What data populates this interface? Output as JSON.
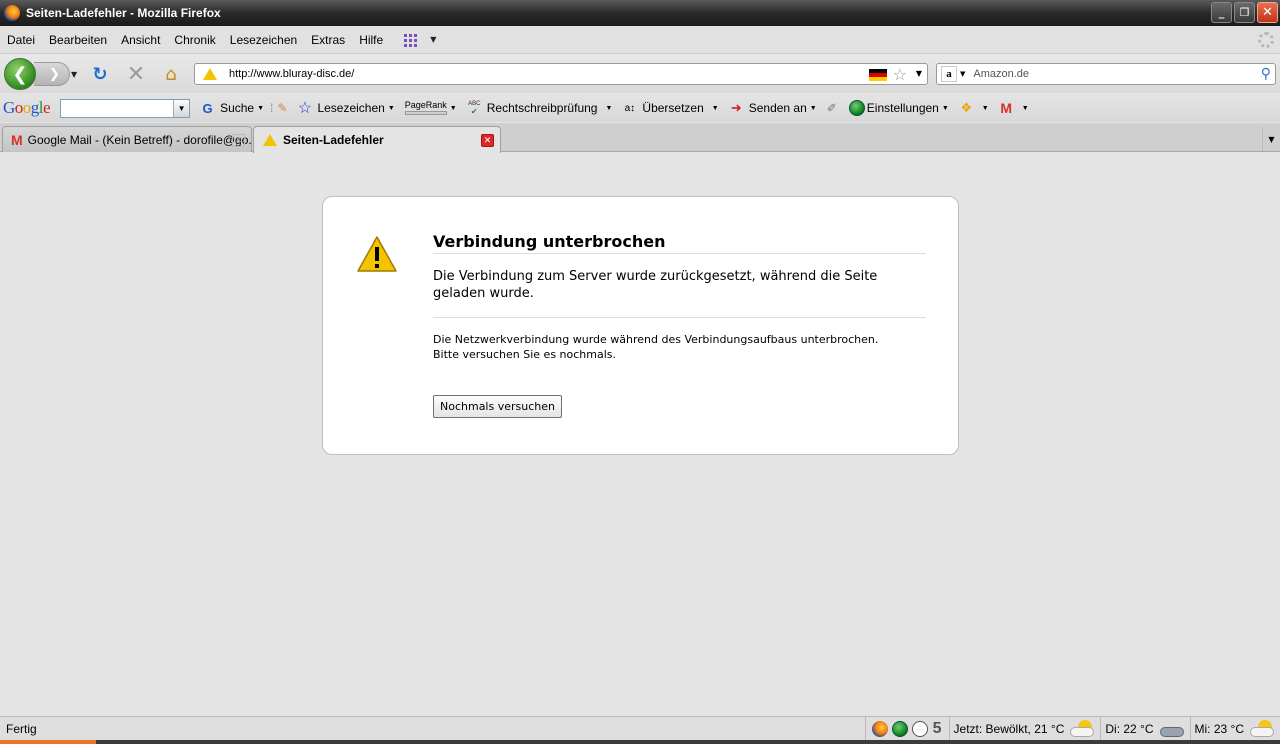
{
  "window": {
    "title": "Seiten-Ladefehler - Mozilla Firefox",
    "buttons": {
      "minimize": "_",
      "maximize": "❐",
      "close": "✕"
    }
  },
  "menubar": {
    "items": [
      "Datei",
      "Bearbeiten",
      "Ansicht",
      "Chronik",
      "Lesezeichen",
      "Extras",
      "Hilfe"
    ]
  },
  "navbar": {
    "url": "http://www.bluray-disc.de/",
    "search_placeholder": "Amazon.de",
    "search_engine_letter": "a"
  },
  "google_toolbar": {
    "logo": [
      "G",
      "o",
      "o",
      "g",
      "l",
      "e"
    ],
    "search_label": "Suche",
    "bookmarks_label": "Lesezeichen",
    "pagerank_label": "PageRank",
    "spellcheck_label": "Rechtschreibprüfung",
    "translate_label": "Übersetzen",
    "send_label": "Senden an",
    "settings_label": "Einstellungen",
    "spellcheck_badge": "ABC",
    "translate_glyph": "a↕"
  },
  "tabs": [
    {
      "label": "Google Mail - (Kein Betreff) - dorofile@go...",
      "active": false
    },
    {
      "label": "Seiten-Ladefehler",
      "active": true
    }
  ],
  "error_page": {
    "title": "Verbindung unterbrochen",
    "short_desc": "Die Verbindung zum Server wurde zurückgesetzt, während die Seite geladen wurde.",
    "long_desc_1": "Die Netzwerkverbindung wurde während des Verbindungsaufbaus unterbrochen.",
    "long_desc_2": "Bitte versuchen Sie es nochmals.",
    "retry_label": "Nochmals versuchen"
  },
  "statusbar": {
    "status": "Fertig",
    "counter": "5",
    "weather_now": "Jetzt: Bewölkt, 21 °C",
    "weather_tue": "Di: 22 °C",
    "weather_wed": "Mi: 23 °C"
  },
  "colors": {
    "accent_green": "#2d8a1e",
    "warning_yellow": "#f2c300",
    "close_red": "#c3321a",
    "google_blue": "#1a55d0"
  },
  "icons": [
    "firefox-icon",
    "back-arrow-icon",
    "forward-arrow-icon",
    "reload-icon",
    "stop-icon",
    "home-icon",
    "warning-icon",
    "german-flag-icon",
    "bookmark-star-icon",
    "amazon-icon",
    "magnifier-icon",
    "gmail-icon",
    "clock-icon",
    "weather-cloud-icon",
    "weather-rain-icon"
  ]
}
